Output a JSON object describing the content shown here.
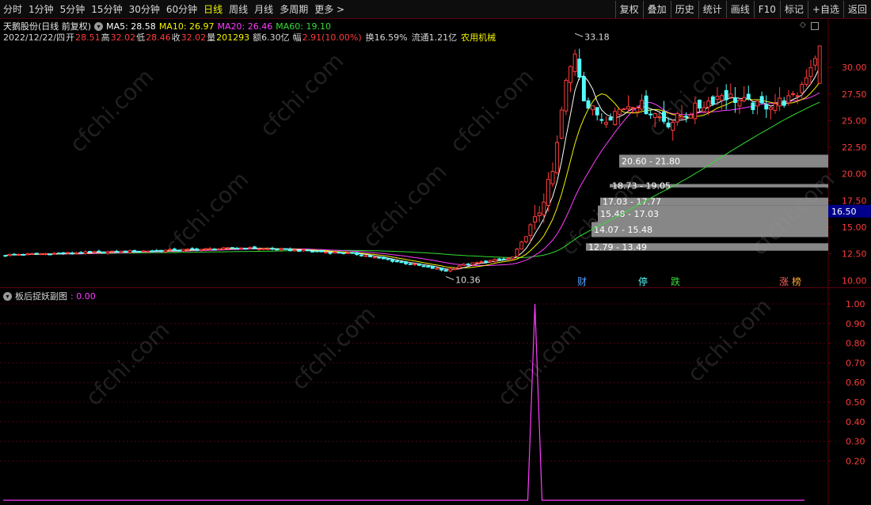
{
  "toolbar": {
    "periods": [
      "分时",
      "1分钟",
      "5分钟",
      "15分钟",
      "30分钟",
      "60分钟",
      "日线",
      "周线",
      "月线",
      "多周期",
      "更多"
    ],
    "active_period": "日线",
    "more_arrow": ">",
    "actions": [
      "复权",
      "叠加",
      "历史",
      "统计",
      "画线",
      "F10",
      "标记",
      "+自选",
      "返回"
    ]
  },
  "stock": {
    "title": "天鹅股份(日线 前复权)",
    "ma5": "MA5: 28.58",
    "ma10": "MA10: 26.97",
    "ma20": "MA20: 26.46",
    "ma60": "MA60: 19.10",
    "date": "2022/12/22/四",
    "open_label": "开",
    "open": "28.51",
    "high_label": "高",
    "high": "32.02",
    "low_label": "低",
    "low": "28.46",
    "close_label": "收",
    "close": "32.02",
    "volume_label": "量",
    "volume": "201293",
    "amount": "额6.30亿",
    "change_label": "幅",
    "change": "2.91(10.00%)",
    "turnover": "换16.59%",
    "float": "流通1.21亿",
    "industry": "农用机械"
  },
  "main_axis": {
    "ticks": [
      "30.00",
      "27.50",
      "25.00",
      "22.50",
      "20.00",
      "17.50",
      "15.00",
      "12.50",
      "10.00"
    ],
    "current_price": "16.50"
  },
  "annotations": {
    "high_marker": "33.18",
    "low_marker": "10.36",
    "event_markers": [
      "财",
      "停",
      "跌",
      "涨",
      "榜"
    ]
  },
  "chip_zones": [
    {
      "label": "20.60 - 21.80"
    },
    {
      "label": "18.73 - 19.05"
    },
    {
      "label": "17.03 - 17.77"
    },
    {
      "label": "15.48 - 17.03"
    },
    {
      "label": "14.07 - 15.48"
    },
    {
      "label": "12.79 - 13.49"
    }
  ],
  "sub_panel": {
    "title": "板后捉妖副图",
    "value": ": 0.00",
    "ticks": [
      "1.00",
      "0.90",
      "0.80",
      "0.70",
      "0.60",
      "0.50",
      "0.40",
      "0.30",
      "0.20"
    ]
  },
  "watermark": "cfchi.com",
  "colors": {
    "ma5": "#ffffff",
    "ma10": "#f4f400",
    "ma20": "#ff3cff",
    "ma60": "#33dd33",
    "up": "#ff3c3c",
    "down": "#54ffff",
    "grid": "#5a0010",
    "signal": "#ff3cff"
  },
  "chart_data": {
    "type": "candlestick",
    "ylim": [
      9.5,
      33.5
    ],
    "last_bars": [
      {
        "date": "2022/12/22",
        "open": 28.51,
        "high": 32.02,
        "low": 28.46,
        "close": 32.02
      }
    ],
    "indicator": {
      "name": "板后捉妖副图",
      "ylim": [
        0,
        1.0
      ],
      "signal_peak": 1.0
    }
  }
}
